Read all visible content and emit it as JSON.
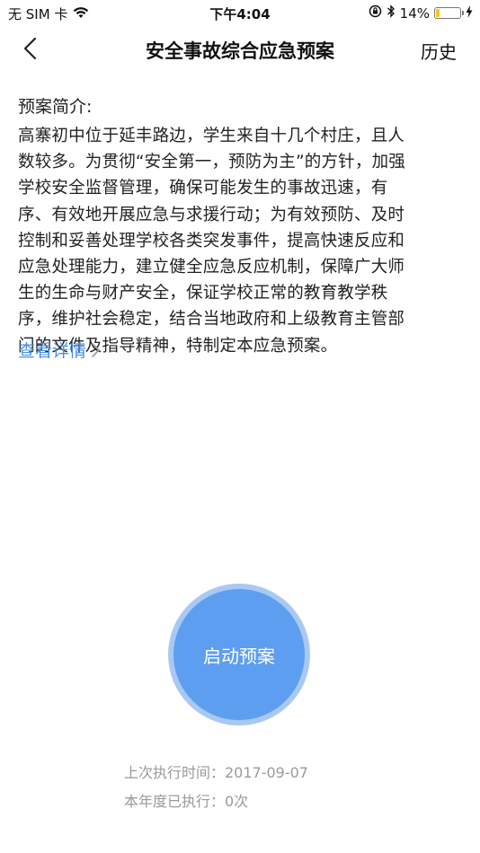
{
  "status_bar": {
    "carrier": "无 SIM 卡",
    "time": "下午4:04",
    "battery_percent": "14%",
    "battery_level": 0.14
  },
  "nav": {
    "title": "安全事故综合应急预案",
    "history_label": "历史"
  },
  "intro": {
    "heading": "预案简介:",
    "lines": [
      "高寨初中位于延丰路边，学生来自十几个村庄，且人",
      "数较多。为贯彻“安全第一，预防为主”的方针，加强",
      "学校安全监督管理，确保可能发生的事故迅速，有",
      "序、有效地开展应急与求援行动；为有效预防、及时",
      "控制和妥善处理学校各类突发事件，提高快速反应和",
      "应急处理能力，建立健全应急反应机制，保障广大师",
      "生的生命与财产安全，保证学校正常的教育教学秩",
      "序，维护社会稳定，结合当地政府和上级教育主管部",
      "门的文件及指导精神，特制定本应急预案。"
    ],
    "details_link": "查看详情"
  },
  "action": {
    "start_label": "启动预案"
  },
  "stats": {
    "last_run": "上次执行时间：2017-09-07",
    "year_count": "本年度已执行：0次"
  },
  "colors": {
    "accent": "#5d9ef0",
    "accent_ring": "#a9c8f3",
    "link": "#4a90e2",
    "muted": "#9a9a9a",
    "battery": "#f5c518"
  }
}
